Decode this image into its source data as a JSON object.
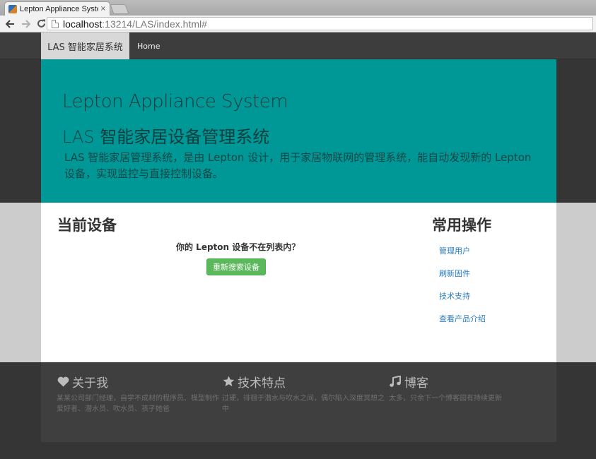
{
  "browser": {
    "tab_title": "Lepton Appliance System",
    "tab_close": "×",
    "url_host": "localhost",
    "url_rest": ":13214/LAS/index.html#"
  },
  "navbar": {
    "brand": "LAS 智能家居系统",
    "home": "Home"
  },
  "jumbotron": {
    "title": "Lepton Appliance System",
    "subtitle": "LAS 智能家居设备管理系统",
    "description": "LAS 智能家居管理系统，是由 Lepton 设计，用于家居物联网的管理系统，能自动发现新的 Lepton 设备，实现监控与直接控制设备。",
    "background_color": "#009797"
  },
  "main": {
    "heading": "当前设备",
    "notice": "你的 Lepton 设备不在列表内？",
    "rescan_button": "重新搜索设备",
    "button_color": "#5cb85c"
  },
  "sidebar": {
    "heading": "常用操作",
    "links": [
      {
        "label": "管理用户"
      },
      {
        "label": "刷新固件"
      },
      {
        "label": "技术支持"
      },
      {
        "label": "查看产品介绍"
      }
    ]
  },
  "footer": {
    "columns": [
      {
        "icon": "heart-icon",
        "title": "关于我",
        "text": "某某公司部门经理，自学不成材的程序员、模型制作爱好者、潜水员、吹水员、孩子她爸"
      },
      {
        "icon": "star-icon",
        "title": "技术特点",
        "text": "过硬，徘徊于潜水与吹水之间，偶尔陷入深度冥想之中"
      },
      {
        "icon": "music-icon",
        "title": "博客",
        "text": "太多，只余下一个博客园有持续更新"
      }
    ]
  }
}
